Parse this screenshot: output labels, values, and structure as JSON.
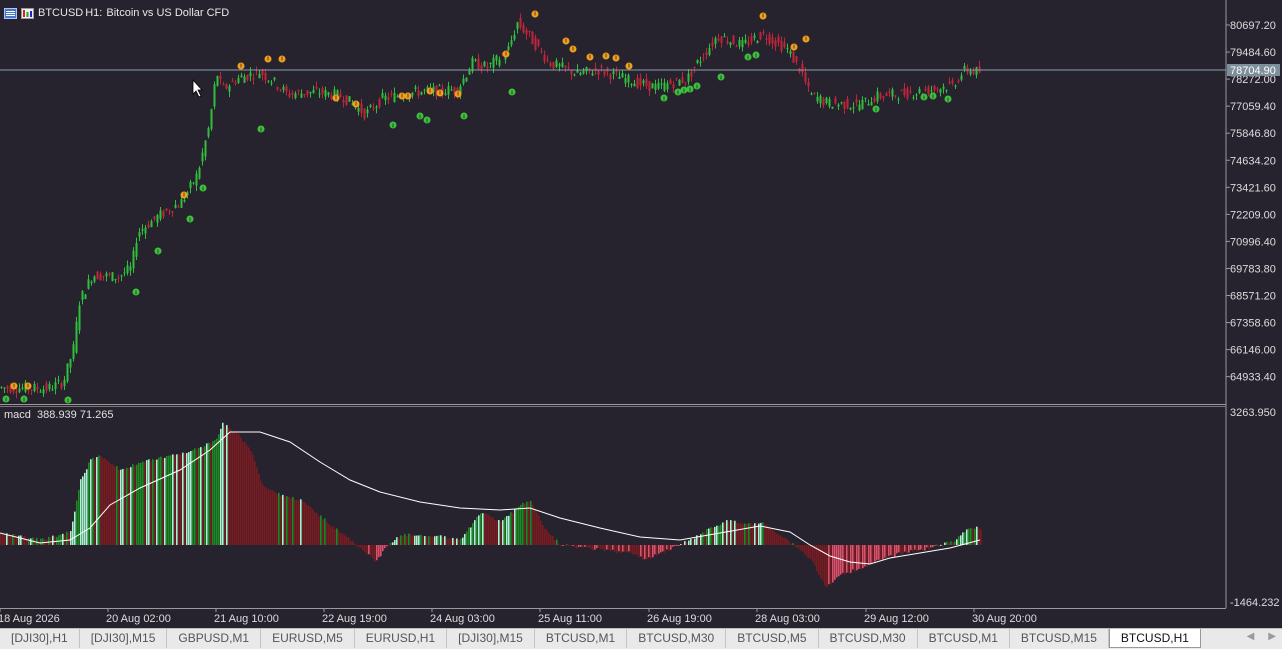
{
  "window": {
    "symbol": "BTCUSD",
    "timeframe": "H1:",
    "description": "Bitcoin vs US Dollar CFD"
  },
  "price_axis": {
    "labels": [
      "80697.20",
      "79484.60",
      "78272.00",
      "77059.40",
      "75846.80",
      "74634.20",
      "73421.60",
      "72209.00",
      "70996.40",
      "69783.80",
      "68571.20",
      "67358.60",
      "66146.00",
      "64933.40"
    ],
    "current_price": "78704.90"
  },
  "indicator": {
    "name": "macd",
    "values": "388.939 71.265",
    "axis_top": "3263.950",
    "axis_bottom": "-1464.232"
  },
  "time_axis": {
    "labels": [
      "18 Aug 2026",
      "20 Aug 02:00",
      "21 Aug 10:00",
      "22 Aug 19:00",
      "24 Aug 03:00",
      "25 Aug 11:00",
      "26 Aug 19:00",
      "28 Aug 03:00",
      "29 Aug 12:00",
      "30 Aug 20:00"
    ]
  },
  "tabs": [
    {
      "label": "[DJI30],H1"
    },
    {
      "label": "[DJI30],M15"
    },
    {
      "label": "GBPUSD,M1"
    },
    {
      "label": "EURUSD,M5"
    },
    {
      "label": "EURUSD,H1"
    },
    {
      "label": "[DJI30],M15"
    },
    {
      "label": "BTCUSD,M1"
    },
    {
      "label": "BTCUSD,M30"
    },
    {
      "label": "BTCUSD,M5"
    },
    {
      "label": "BTCUSD,M30"
    },
    {
      "label": "BTCUSD,M1"
    },
    {
      "label": "BTCUSD,M15"
    },
    {
      "label": "BTCUSD,H1",
      "active": true
    }
  ],
  "colors": {
    "background": "#27232e",
    "bull_candle": "#2fbf3c",
    "bear_candle": "#c0243a",
    "up_fractal": "#f0a020",
    "down_fractal": "#3fbf3f",
    "macd_pos_up": "#a6f5cf",
    "macd_pos_down": "#1c8a22",
    "macd_neg": "#7a1b22",
    "signal_line": "#ffffff",
    "axis_text": "#dcdcdc"
  }
}
